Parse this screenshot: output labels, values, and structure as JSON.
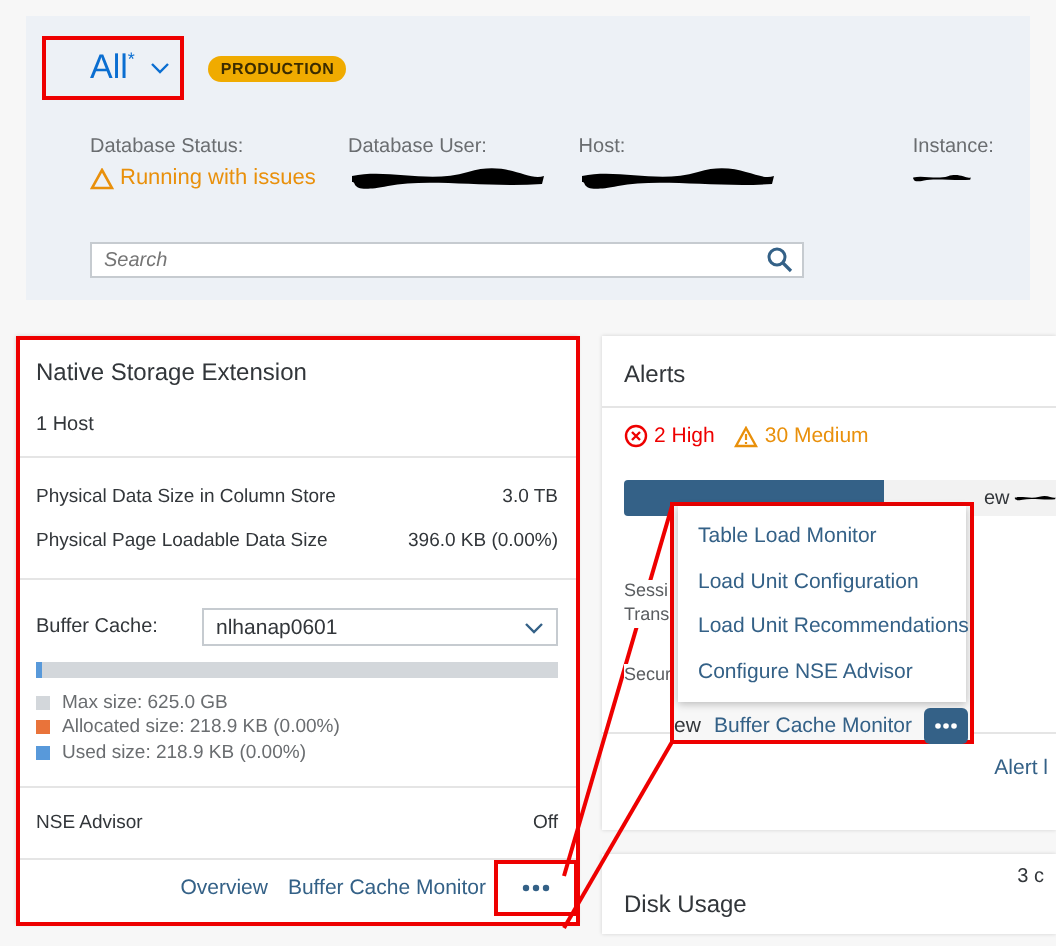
{
  "header": {
    "scope": {
      "label": "All",
      "marker": "*"
    },
    "badge": "PRODUCTION",
    "fields": [
      {
        "label": "Database Status:",
        "kind": "warning",
        "value": "Running with issues"
      },
      {
        "label": "Database User:",
        "kind": "redacted"
      },
      {
        "label": "Host:",
        "kind": "redacted"
      },
      {
        "label": "Instance:",
        "kind": "redacted"
      }
    ],
    "search": {
      "placeholder": "Search"
    }
  },
  "nse_card": {
    "title": "Native Storage Extension",
    "subtitle": "1 Host",
    "metrics": [
      {
        "label": "Physical Data Size in Column Store",
        "value": "3.0 TB"
      },
      {
        "label": "Physical Page Loadable Data Size",
        "value": "396.0 KB (0.00%)"
      }
    ],
    "buffer_cache": {
      "label": "Buffer Cache:",
      "value": "nlhanap0601",
      "level": 0.01
    },
    "legend": [
      {
        "text": "Max size: 625.0 GB",
        "color": "#d3d7db"
      },
      {
        "text": "Allocated size: 218.9 KB (0.00%)",
        "color": "#e9733a"
      },
      {
        "text": "Used size: 218.9 KB (0.00%)",
        "color": "#5899da"
      }
    ],
    "advisor": {
      "label": "NSE Advisor",
      "value": "Off"
    },
    "links": [
      "Overview",
      "Buffer Cache Monitor"
    ]
  },
  "alerts_card": {
    "title": "Alerts",
    "counts": [
      {
        "kind": "high",
        "text": "2 High"
      },
      {
        "kind": "medium",
        "text": "30 Medium"
      }
    ],
    "bar_fragment": "ew",
    "rows": [
      "Sessi",
      "Trans",
      "Secur"
    ],
    "footer_link": "Alert l"
  },
  "disk_card": {
    "title": "Disk Usage",
    "fragment": "3 c"
  },
  "callout": {
    "menu": [
      "Table Load Monitor",
      "Load Unit Configuration",
      "Load Unit Recommendations",
      "Configure NSE Advisor"
    ],
    "footer_fragment": "ew",
    "footer_link": "Buffer Cache Monitor"
  }
}
